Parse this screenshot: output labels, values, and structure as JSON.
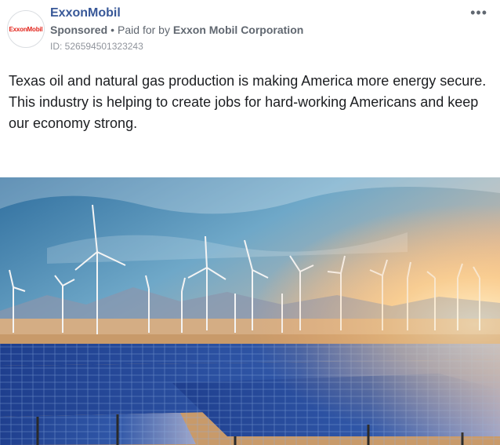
{
  "ad": {
    "logo_text": "ExxonMobil",
    "page_name": "ExxonMobil",
    "sponsored": "Sponsored",
    "separator": "•",
    "paid_for_prefix": "Paid for by",
    "paid_for_by": "Exxon Mobil Corporation",
    "ad_id": "ID: 526594501323243",
    "more_icon": "more-options-icon",
    "body_text": "Texas oil and natural gas production is making America more energy secure. This industry is helping to create jobs for hard-working Americans and keep our economy strong."
  },
  "image": {
    "subject": "wind turbines and solar panels at sunset",
    "colors": {
      "sky_top": "#3d7fae",
      "sun_glow": "#ffd79a",
      "panel": "#2a4fa0",
      "ground": "#c89a6a"
    }
  }
}
